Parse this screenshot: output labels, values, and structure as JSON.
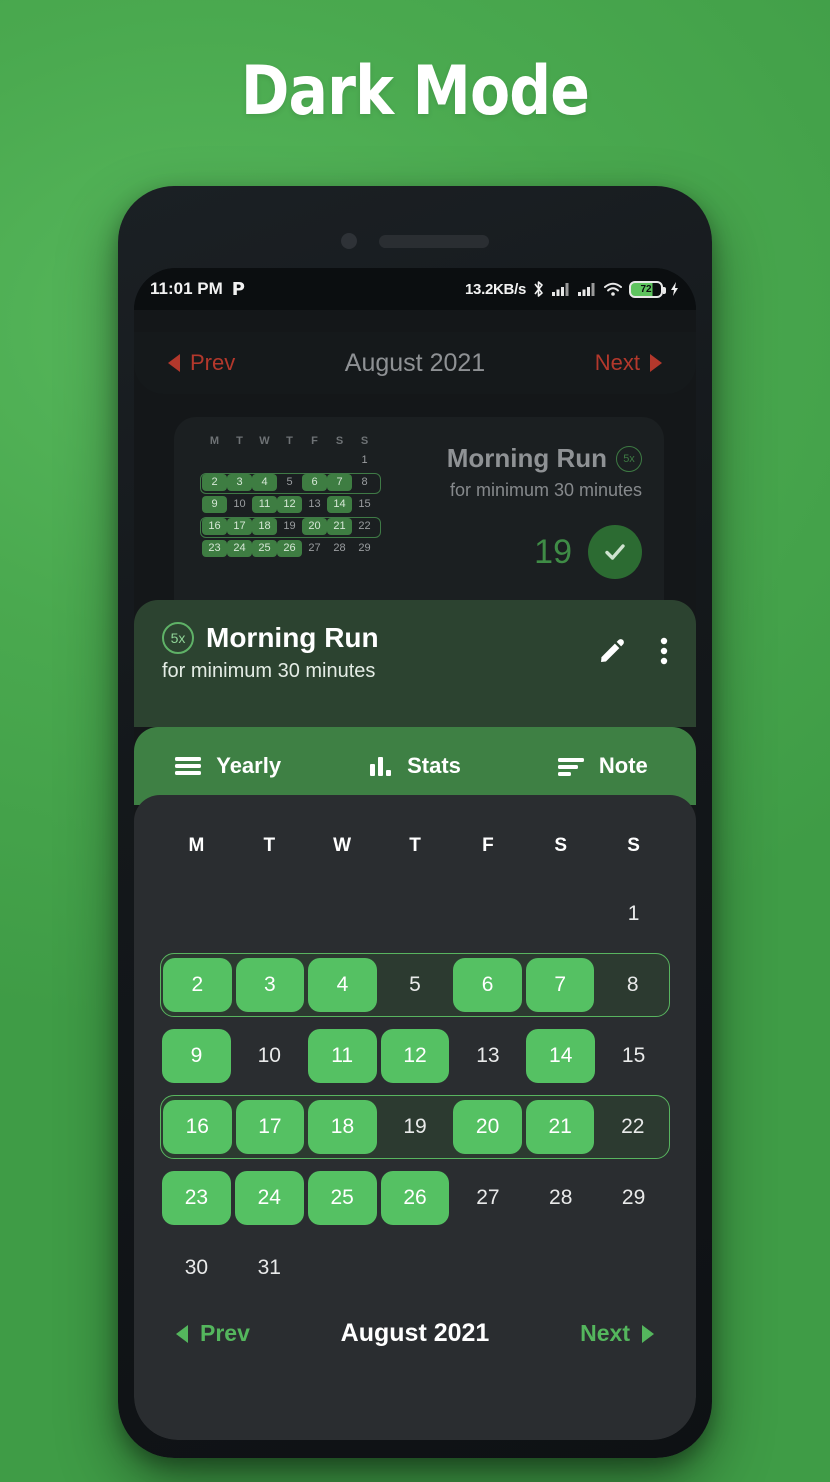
{
  "heading": "Dark Mode",
  "colors": {
    "page_background_green": "#4CAF50",
    "accent_green": "#55c163",
    "sheet_header_green": "#2c4330",
    "tab_bar_green": "#3e8044",
    "panel_dark": "#2a2d30",
    "screen_dark": "#141719",
    "prev_next_red": "#b3382c"
  },
  "status_bar": {
    "time": "11:01 PM",
    "app_glyph": "P",
    "network_speed": "13.2KB/s",
    "bluetooth_icon": "bluetooth-icon",
    "signal_icon_1": "signal-bars-icon",
    "signal_icon_2": "signal-bars-icon",
    "wifi_icon": "wifi-icon",
    "battery_percent": "72",
    "charging_icon": "charging-bolt-icon"
  },
  "background_app": {
    "month_nav": {
      "prev": "Prev",
      "title": "August 2021",
      "next": "Next"
    },
    "card": {
      "title": "Morning Run",
      "badge": "5x",
      "subtitle": "for minimum 30 minutes",
      "count": "19",
      "check_icon": "check-circle-icon"
    },
    "mini_calendar": {
      "dow": [
        "M",
        "T",
        "W",
        "T",
        "F",
        "S",
        "S"
      ],
      "rows": [
        {
          "goal_met": false,
          "days": [
            "",
            "",
            "",
            "",
            "",
            "",
            "1"
          ],
          "done": []
        },
        {
          "goal_met": true,
          "days": [
            "2",
            "3",
            "4",
            "5",
            "6",
            "7",
            "8"
          ],
          "done": [
            2,
            3,
            4,
            6,
            7
          ]
        },
        {
          "goal_met": false,
          "days": [
            "9",
            "10",
            "11",
            "12",
            "13",
            "14",
            "15"
          ],
          "done": [
            9,
            11,
            12,
            14
          ]
        },
        {
          "goal_met": true,
          "days": [
            "16",
            "17",
            "18",
            "19",
            "20",
            "21",
            "22"
          ],
          "done": [
            16,
            17,
            18,
            20,
            21
          ]
        },
        {
          "goal_met": false,
          "days": [
            "23",
            "24",
            "25",
            "26",
            "27",
            "28",
            "29"
          ],
          "done": [
            23,
            24,
            25,
            26
          ]
        }
      ]
    }
  },
  "sheet": {
    "habit_badge": "5x",
    "habit_title": "Morning Run",
    "habit_subtitle": "for minimum 30 minutes",
    "edit_icon": "pencil-edit-icon",
    "more_icon": "more-vertical-icon",
    "tabs": [
      {
        "label": "Yearly",
        "icon": "list-lines-icon",
        "active": true
      },
      {
        "label": "Stats",
        "icon": "bar-chart-icon",
        "active": false
      },
      {
        "label": "Note",
        "icon": "note-lines-icon",
        "active": false
      }
    ],
    "calendar": {
      "day_headers": [
        "M",
        "T",
        "W",
        "T",
        "F",
        "S",
        "S"
      ],
      "weeks": [
        {
          "goal_met": false,
          "cells": [
            "",
            "",
            "",
            "",
            "",
            "",
            "1"
          ],
          "completed": []
        },
        {
          "goal_met": true,
          "cells": [
            "2",
            "3",
            "4",
            "5",
            "6",
            "7",
            "8"
          ],
          "completed": [
            "2",
            "3",
            "4",
            "6",
            "7"
          ]
        },
        {
          "goal_met": false,
          "cells": [
            "9",
            "10",
            "11",
            "12",
            "13",
            "14",
            "15"
          ],
          "completed": [
            "9",
            "11",
            "12",
            "14"
          ]
        },
        {
          "goal_met": true,
          "cells": [
            "16",
            "17",
            "18",
            "19",
            "20",
            "21",
            "22"
          ],
          "completed": [
            "16",
            "17",
            "18",
            "20",
            "21"
          ]
        },
        {
          "goal_met": false,
          "cells": [
            "23",
            "24",
            "25",
            "26",
            "27",
            "28",
            "29"
          ],
          "completed": [
            "23",
            "24",
            "25",
            "26"
          ]
        },
        {
          "goal_met": false,
          "cells": [
            "30",
            "31",
            "",
            "",
            "",
            "",
            ""
          ],
          "completed": []
        }
      ]
    },
    "footer_nav": {
      "prev": "Prev",
      "month": "August 2021",
      "next": "Next"
    }
  }
}
